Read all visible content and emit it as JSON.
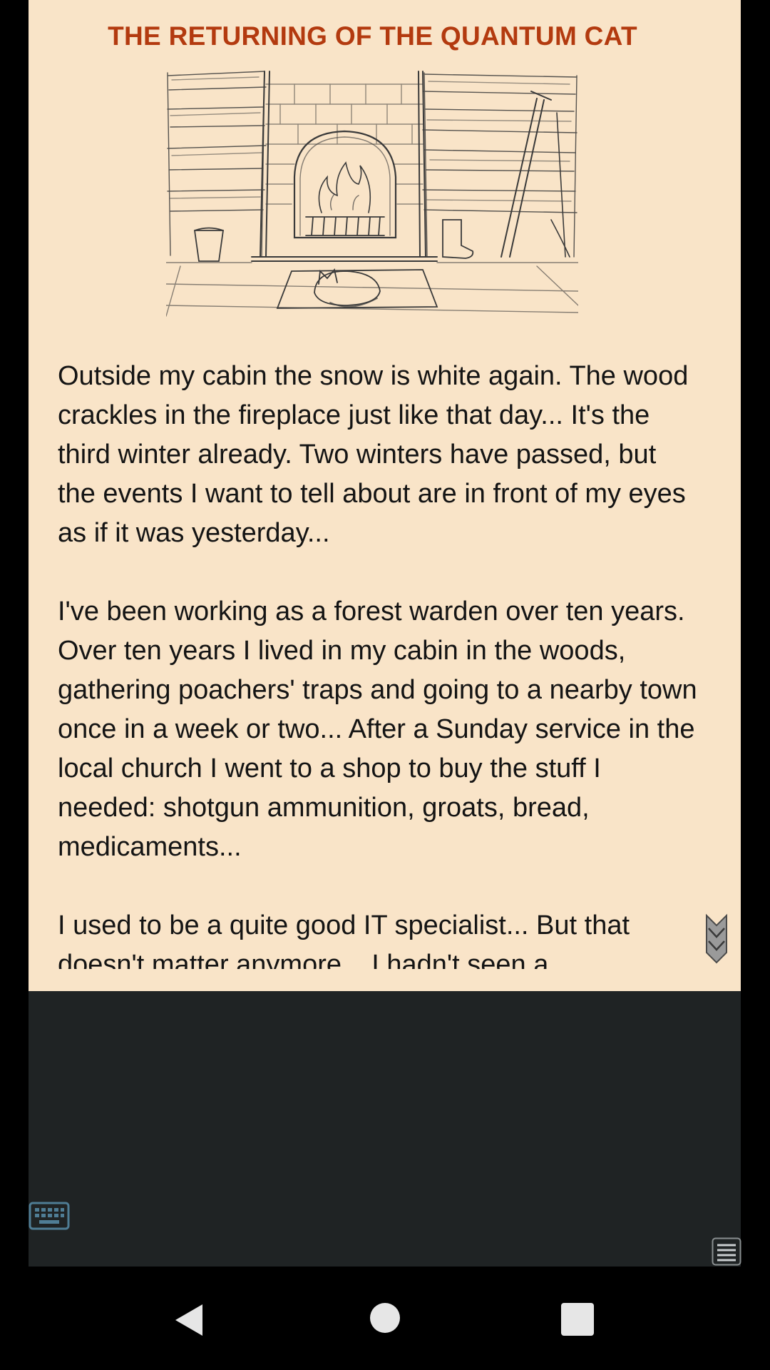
{
  "story": {
    "title": "THE RETURNING OF THE QUANTUM CAT",
    "illustration_icon": "fireplace-with-sleeping-cat-sketch",
    "paragraphs": [
      "Outside my cabin the snow is white again. The wood crackles in the fireplace just like that day... It's the third winter already. Two winters have passed, but the events I want to tell about are in front of my eyes as if it was yesterday...",
      "I've been working as a forest warden over ten years. Over ten years I lived in my cabin in the woods, gathering poachers' traps and going to a nearby town once in a week or two... After a Sunday service in the local church I went to a shop to buy the stuff I needed: shotgun ammunition, groats, bread, medicaments...",
      "I used to be a quite good IT specialist... But that doesn't matter anymore... I hadn't seen a"
    ],
    "scroll_icon": "double-chevron-down-icon"
  },
  "controls": {
    "keyboard_icon": "keyboard-icon",
    "menu_icon": "menu-icon"
  },
  "nav": {
    "back_icon": "back-triangle-icon",
    "home_icon": "home-circle-icon",
    "recents_icon": "recents-square-icon"
  },
  "colors": {
    "page_background": "#f9e4c8",
    "title": "#b33a0f",
    "text": "#141414",
    "input_area": "#1f2324",
    "keyboard_icon": "#4f7d95"
  }
}
